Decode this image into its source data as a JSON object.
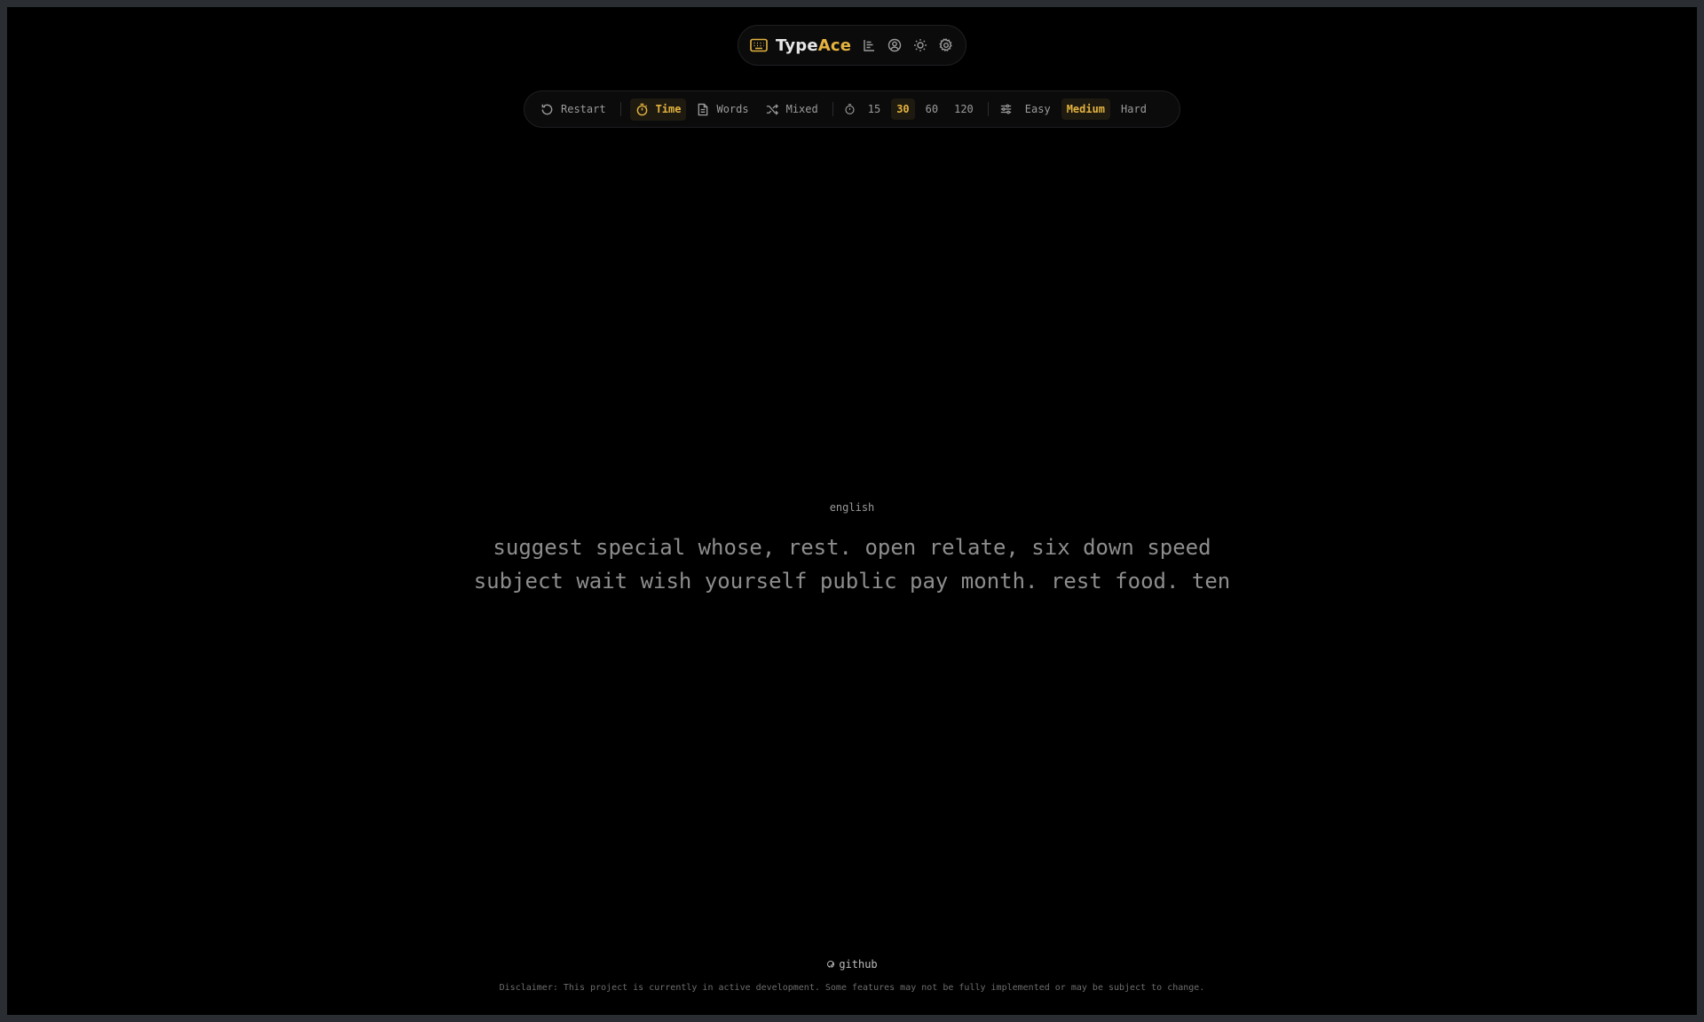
{
  "app": {
    "brand_prefix": "Type",
    "brand_accent": "Ace",
    "accent_color": "#e4b33f"
  },
  "header": {
    "icons": [
      "keyboard-icon",
      "leaderboard-icon",
      "account-icon",
      "theme-sun-icon",
      "settings-gear-icon"
    ]
  },
  "toolbar": {
    "restart_label": "Restart",
    "mode_time_label": "Time",
    "mode_words_label": "Words",
    "mode_mixed_label": "Mixed",
    "durations": [
      "15",
      "30",
      "60",
      "120"
    ],
    "selected_duration": "30",
    "difficulties": [
      "Easy",
      "Medium",
      "Hard"
    ],
    "selected_difficulty": "Medium",
    "selected_mode": "Time"
  },
  "test": {
    "language": "english",
    "line1": "suggest special whose, rest. open relate, six down speed",
    "line2": "subject wait wish yourself public pay month. rest food. ten"
  },
  "footer": {
    "github_label": "github",
    "disclaimer": "Disclaimer: This project is currently in active development. Some features may not be fully implemented or may be subject to change."
  }
}
